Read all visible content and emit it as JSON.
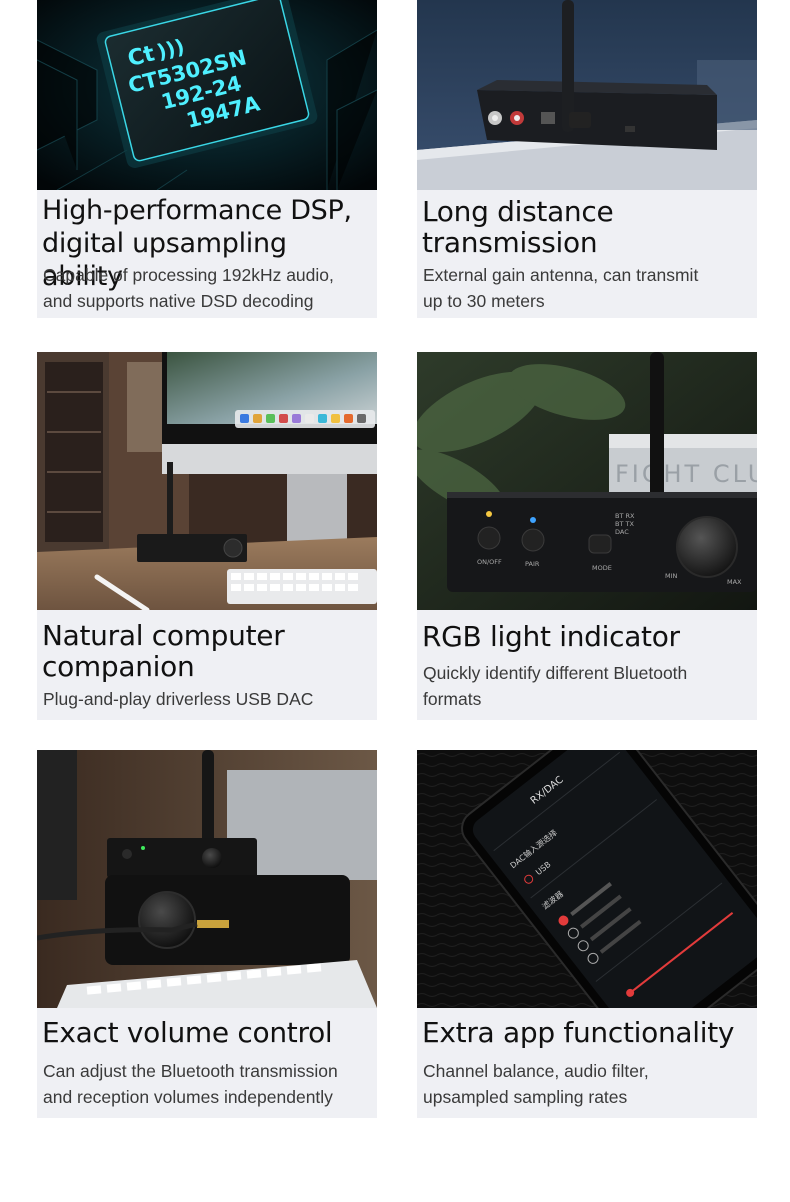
{
  "features": [
    {
      "title": "High-performance DSP,\ndigital upsampling ability",
      "description": "Capable of processing 192kHz audio,\nand supports native DSD decoding",
      "chip_text": [
        "Ct",
        "CT5302SN",
        "192-24",
        "1947A"
      ]
    },
    {
      "title": "Long distance\ntransmission",
      "description": "External gain antenna, can transmit\nup to 30 meters"
    },
    {
      "title": "Natural computer\ncompanion",
      "description": "Plug-and-play driverless USB DAC"
    },
    {
      "title": "RGB light indicator",
      "description": "Quickly identify different Bluetooth\nformats",
      "device_labels": {
        "onoff": "ON/OFF",
        "pair": "PAIR",
        "mode": "MODE",
        "btrx": "BT RX",
        "bttx": "BT TX",
        "dac": "DAC",
        "min": "MIN",
        "max": "MAX",
        "book": "FIGHT CLUB"
      }
    },
    {
      "title": "Exact volume control",
      "description": "Can adjust the Bluetooth transmission\nand reception volumes independently"
    },
    {
      "title": "Extra app functionality",
      "description": "Channel balance, audio filter,\nupsampled sampling rates",
      "app_labels": {
        "header": "RX/DAC",
        "source": "DAC输入源选择",
        "usb": "USB",
        "filter": "滤波器"
      }
    }
  ],
  "colors": {
    "card_bg": "#eff0f4",
    "chip_glow": "#4ff0ff",
    "indicator_yellow": "#f5c842",
    "indicator_blue": "#3ea3ff",
    "app_accent": "#e23b3b"
  }
}
